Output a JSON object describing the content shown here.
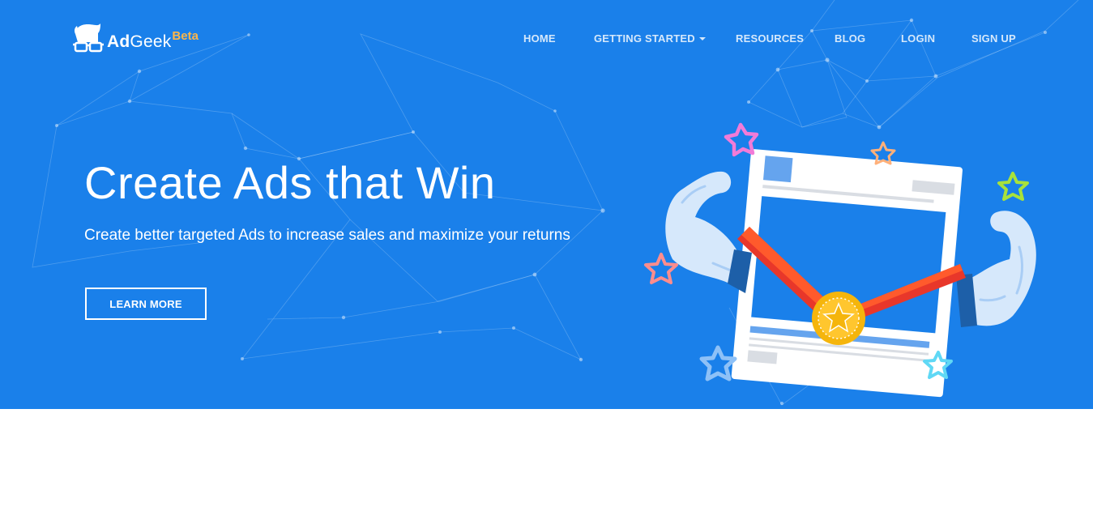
{
  "brand": {
    "name_bold": "Ad",
    "name_regular": "Geek",
    "badge": "Beta",
    "logo_icon": "nerd-glasses-icon"
  },
  "nav": {
    "items": [
      {
        "label": "HOME",
        "dropdown": false
      },
      {
        "label": "GETTING STARTED",
        "dropdown": true
      },
      {
        "label": "RESOURCES",
        "dropdown": false
      },
      {
        "label": "BLOG",
        "dropdown": false
      },
      {
        "label": "LOGIN",
        "dropdown": false
      },
      {
        "label": "SIGN UP",
        "dropdown": false
      }
    ]
  },
  "hero": {
    "title": "Create Ads that Win",
    "subtitle": "Create better targeted Ads to increase sales and maximize your returns",
    "cta_label": "LEARN MORE",
    "illustration_icon": "winning-ad-medal-illustration"
  },
  "colors": {
    "hero_background": "#1a80ea",
    "beta_badge": "#ffb648",
    "ribbon": "#e8372a",
    "medal": "#f5b50c"
  }
}
